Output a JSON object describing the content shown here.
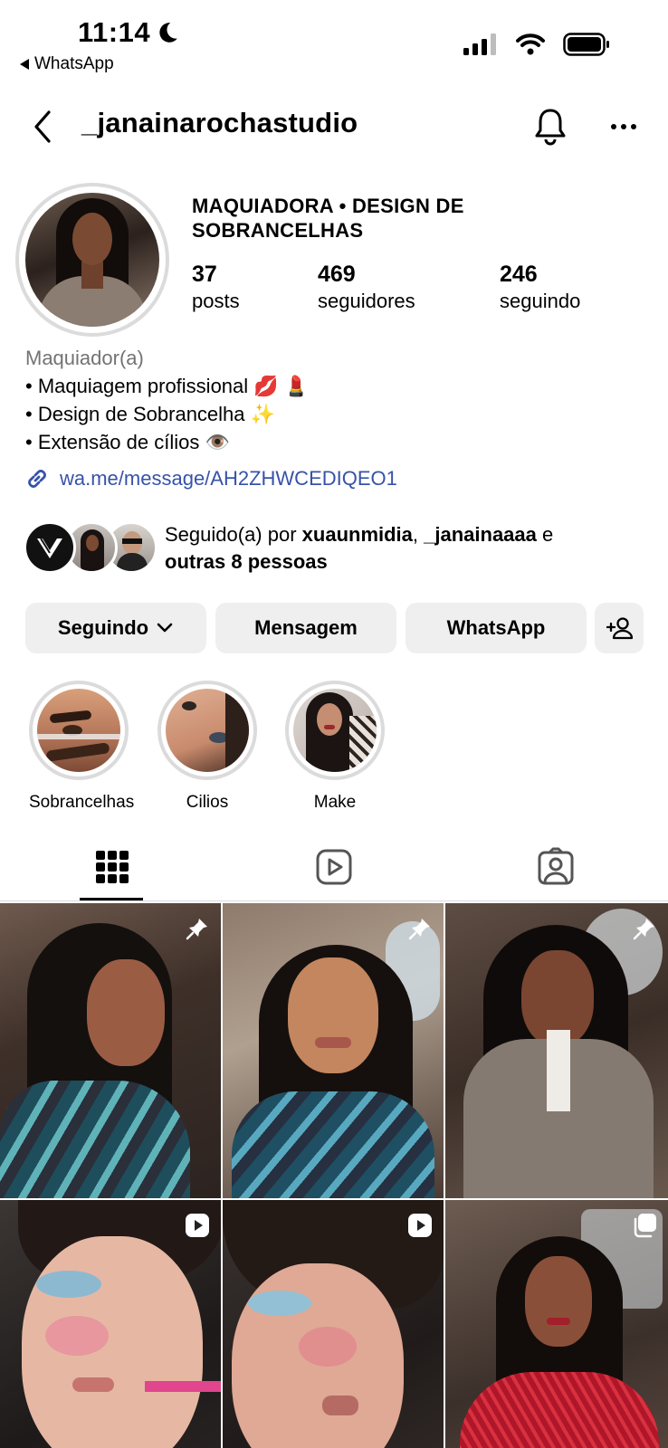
{
  "status_bar": {
    "time": "11:14",
    "back_app": "WhatsApp"
  },
  "header": {
    "username": "_janainarochastudio"
  },
  "profile": {
    "category_title": "MAQUIADORA • DESIGN DE SOBRANCELHAS",
    "stats": [
      {
        "value": "37",
        "label": "posts"
      },
      {
        "value": "469",
        "label": "seguidores"
      },
      {
        "value": "246",
        "label": "seguindo"
      }
    ],
    "bio": {
      "category": "Maquiador(a)",
      "lines": [
        "• Maquiagem profissional 💋 💄",
        "• Design de Sobrancelha ✨",
        "• Extensão de cílios 👁️"
      ],
      "link": "wa.me/message/AH2ZHWCEDIQEO1"
    },
    "followed_by": {
      "prefix": "Seguido(a) por ",
      "user1": "xuaunmidia",
      "sep": ", ",
      "user2": "_janainaaaa",
      "conj": " e",
      "others": "outras 8 pessoas"
    }
  },
  "buttons": {
    "following": "Seguindo",
    "message": "Mensagem",
    "whatsapp": "WhatsApp"
  },
  "highlights": [
    {
      "label": "Sobrancelhas"
    },
    {
      "label": "Cilios"
    },
    {
      "label": "Make"
    }
  ],
  "colors": {
    "link": "#3753a8",
    "button_bg": "#efefef",
    "ring": "#dbdbdb"
  },
  "grid": [
    {
      "badge": "pin-icon"
    },
    {
      "badge": "pin-icon"
    },
    {
      "badge": "pin-icon"
    },
    {
      "badge": "reel-icon"
    },
    {
      "badge": "reel-icon"
    },
    {
      "badge": "carousel-icon"
    }
  ]
}
